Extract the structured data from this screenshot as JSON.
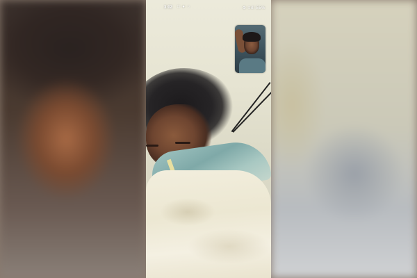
{
  "status_bar": {
    "time": "3:02",
    "left_icons": [
      "message-icon",
      "notification-icon",
      "settings-icon"
    ],
    "right_text": "⚙ ≡ill 55%"
  },
  "call": {
    "remote_video": "remote-participant-video",
    "self_view": "self-view-video"
  }
}
